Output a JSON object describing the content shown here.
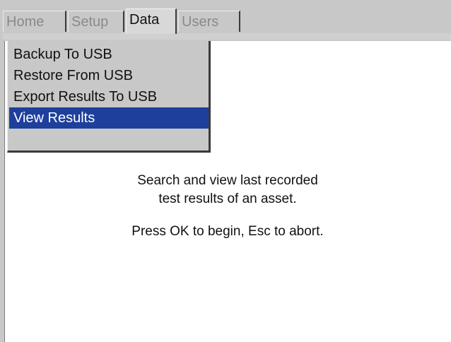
{
  "tabs": [
    {
      "label": "Home",
      "active": false
    },
    {
      "label": "Setup",
      "active": false
    },
    {
      "label": "Data",
      "active": true
    },
    {
      "label": "Users",
      "active": false
    }
  ],
  "menu": {
    "items": [
      {
        "label": "Backup To USB",
        "selected": false
      },
      {
        "label": "Restore From USB",
        "selected": false
      },
      {
        "label": "Export Results To USB",
        "selected": false
      },
      {
        "label": "View Results",
        "selected": true
      }
    ]
  },
  "content": {
    "description_line1": "Search and view last recorded",
    "description_line2": "test results of an asset.",
    "instruction": "Press OK to begin, Esc to abort."
  },
  "colors": {
    "background": "#c8c8c8",
    "panel": "#ffffff",
    "selection": "#1e3f9b",
    "inactive_tab_text": "#8a8a8a"
  }
}
